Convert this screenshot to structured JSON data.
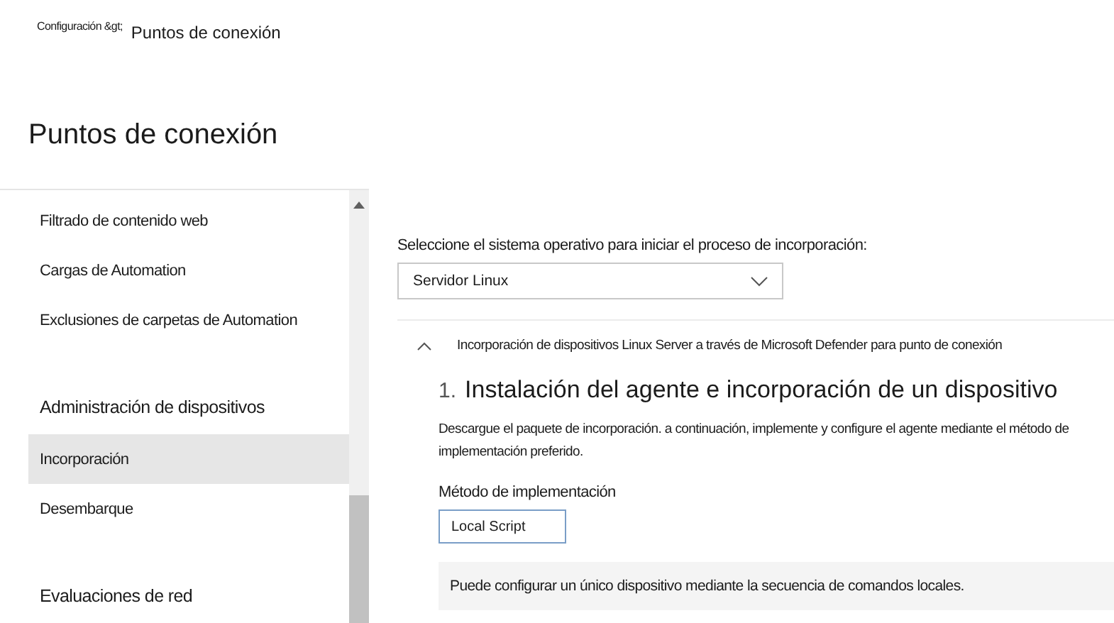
{
  "breadcrumb": {
    "parent": "Configuración &gt;",
    "current": "Puntos de conexión"
  },
  "title": "Puntos de conexión",
  "nav": [
    {
      "label": "Filtrado de contenido web",
      "kind": "item",
      "selected": false
    },
    {
      "label": "Cargas de Automation",
      "kind": "item",
      "selected": false
    },
    {
      "label": "Exclusiones de carpetas de Automation",
      "kind": "item",
      "selected": false
    },
    {
      "label": "Administración de dispositivos",
      "kind": "header",
      "selected": false
    },
    {
      "label": "Incorporación",
      "kind": "item",
      "selected": true
    },
    {
      "label": "Desembarque",
      "kind": "item",
      "selected": false
    },
    {
      "label": "Evaluaciones de red",
      "kind": "header",
      "selected": false
    }
  ],
  "os_select": {
    "label": "Seleccione el sistema operativo para iniciar el proceso de incorporación:",
    "value": "Servidor Linux"
  },
  "section": {
    "title": "Incorporación de dispositivos Linux Server a través de Microsoft Defender para punto de conexión",
    "expanded": true,
    "step_number": "1.",
    "step_title": "Instalación del agente e incorporación de un dispositivo",
    "description": "Descargue el paquete de incorporación. a continuación, implemente y configure el agente mediante el método de implementación preferido.",
    "method_label": "Método de implementación",
    "method_value": "Local Script",
    "info": "Puede configurar un único dispositivo mediante la secuencia de comandos locales."
  }
}
